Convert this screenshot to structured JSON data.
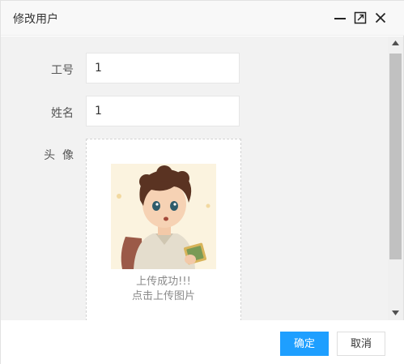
{
  "dialog": {
    "title": "修改用户"
  },
  "form": {
    "employee_id": {
      "label": "工号",
      "value": "1"
    },
    "name": {
      "label": "姓名",
      "value": "1"
    },
    "avatar": {
      "label": "头  像",
      "status_text": "上传成功!!!",
      "hint_text": "点击上传图片"
    }
  },
  "footer": {
    "confirm_label": "确定",
    "cancel_label": "取消"
  },
  "colors": {
    "primary": "#1e9fff",
    "body_bg": "#f2f2f2",
    "titlebar_bg": "#f8f8f8"
  },
  "icons": {
    "minimize": "minimize-icon",
    "maximize": "maximize-icon",
    "close": "close-icon"
  }
}
